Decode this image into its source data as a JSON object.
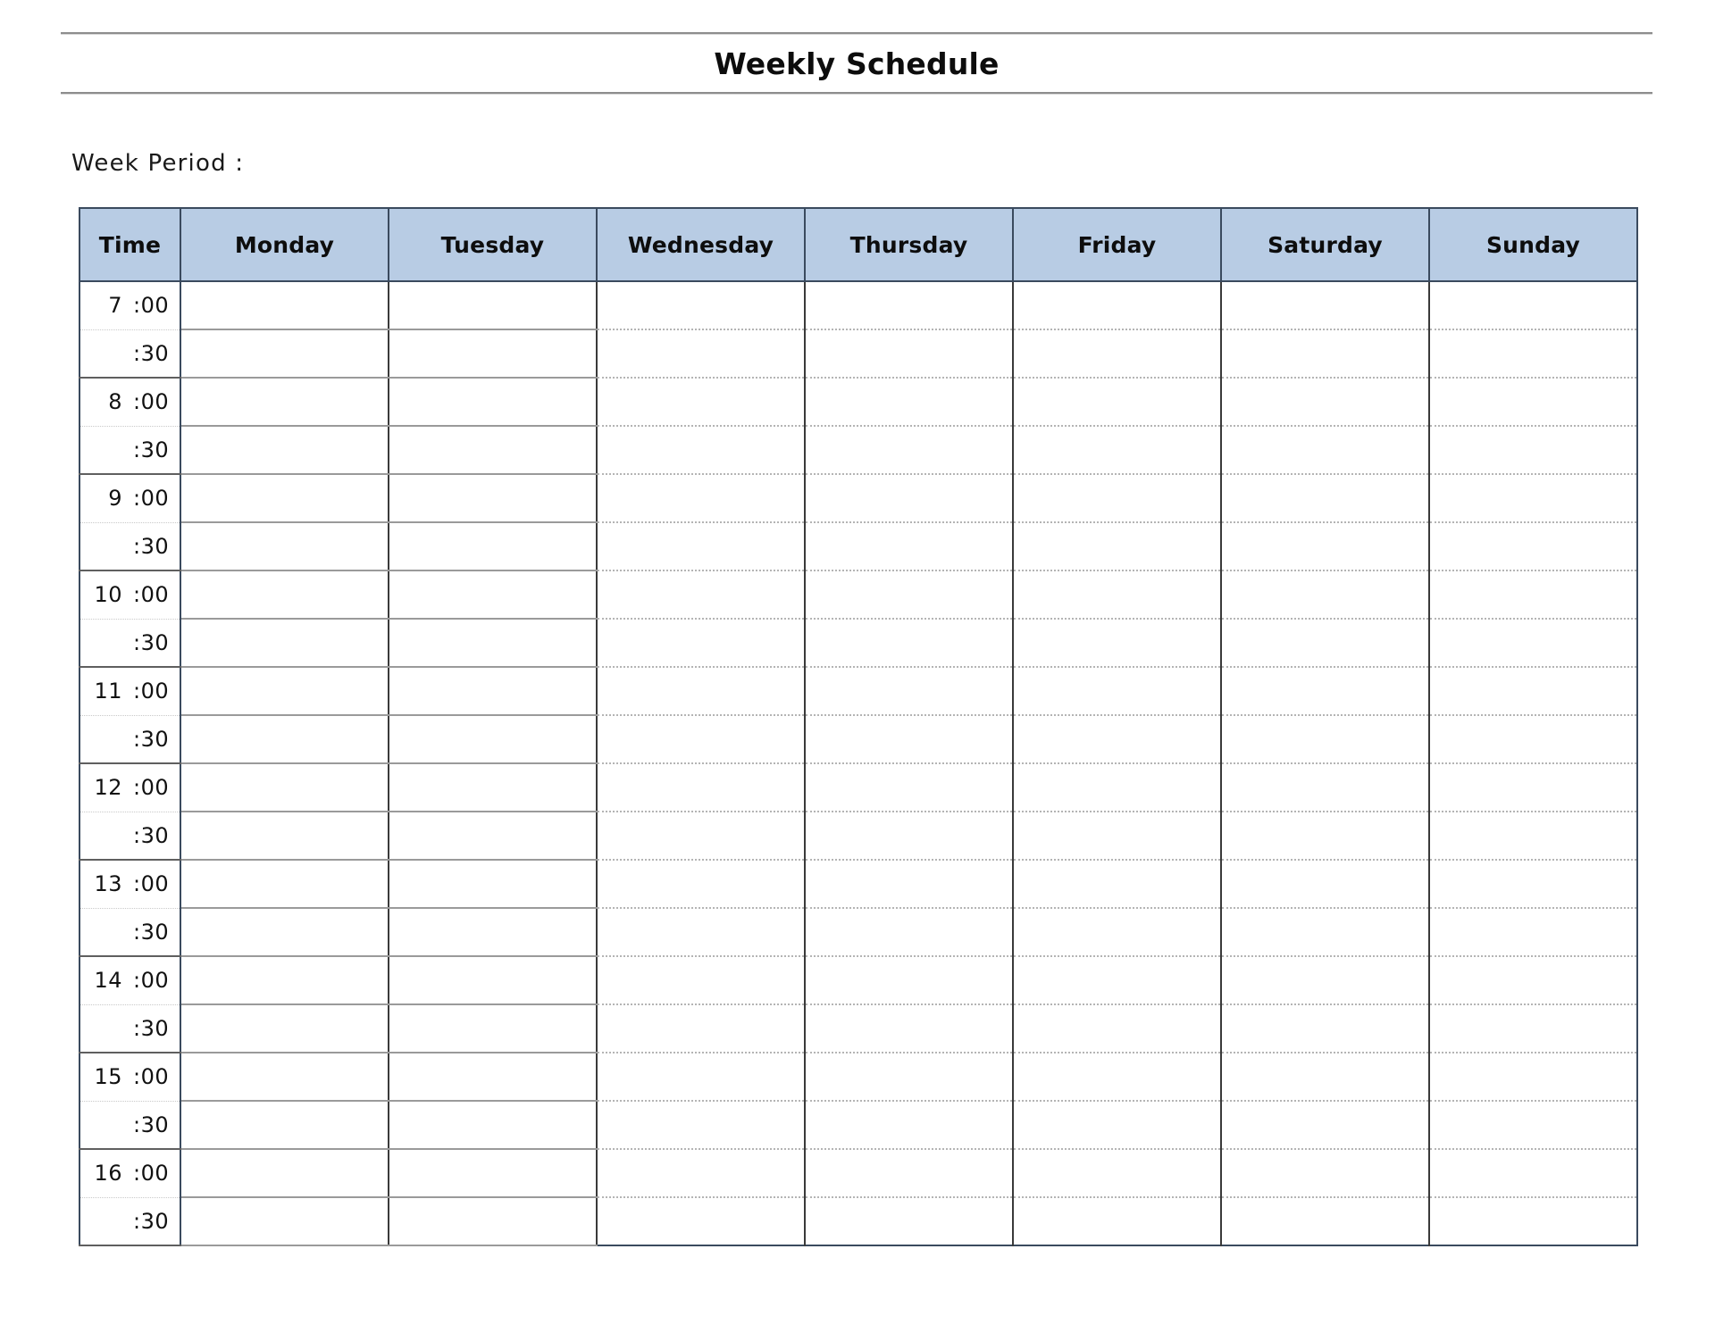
{
  "document": {
    "title": "Weekly Schedule",
    "week_period_label": "Week Period :"
  },
  "table": {
    "columns": [
      {
        "key": "time",
        "label": "Time",
        "type": "time"
      },
      {
        "key": "monday",
        "label": "Monday",
        "type": "day",
        "line_style": "solid"
      },
      {
        "key": "tuesday",
        "label": "Tuesday",
        "type": "day",
        "line_style": "solid"
      },
      {
        "key": "wednesday",
        "label": "Wednesday",
        "type": "day",
        "line_style": "dotted"
      },
      {
        "key": "thursday",
        "label": "Thursday",
        "type": "day",
        "line_style": "dotted"
      },
      {
        "key": "friday",
        "label": "Friday",
        "type": "day",
        "line_style": "dotted"
      },
      {
        "key": "saturday",
        "label": "Saturday",
        "type": "day",
        "line_style": "dotted"
      },
      {
        "key": "sunday",
        "label": "Sunday",
        "type": "day",
        "line_style": "dotted"
      }
    ],
    "header_background": "#b8cce4",
    "header_border": "#3a4a5e",
    "rows": [
      {
        "hour": "7",
        "mins": ":00",
        "slot": "00"
      },
      {
        "hour": "",
        "mins": ":30",
        "slot": "30"
      },
      {
        "hour": "8",
        "mins": ":00",
        "slot": "00"
      },
      {
        "hour": "",
        "mins": ":30",
        "slot": "30"
      },
      {
        "hour": "9",
        "mins": ":00",
        "slot": "00"
      },
      {
        "hour": "",
        "mins": ":30",
        "slot": "30"
      },
      {
        "hour": "10",
        "mins": ":00",
        "slot": "00"
      },
      {
        "hour": "",
        "mins": ":30",
        "slot": "30"
      },
      {
        "hour": "11",
        "mins": ":00",
        "slot": "00"
      },
      {
        "hour": "",
        "mins": ":30",
        "slot": "30"
      },
      {
        "hour": "12",
        "mins": ":00",
        "slot": "00"
      },
      {
        "hour": "",
        "mins": ":30",
        "slot": "30"
      },
      {
        "hour": "13",
        "mins": ":00",
        "slot": "00"
      },
      {
        "hour": "",
        "mins": ":30",
        "slot": "30"
      },
      {
        "hour": "14",
        "mins": ":00",
        "slot": "00"
      },
      {
        "hour": "",
        "mins": ":30",
        "slot": "30"
      },
      {
        "hour": "15",
        "mins": ":00",
        "slot": "00"
      },
      {
        "hour": "",
        "mins": ":30",
        "slot": "30"
      },
      {
        "hour": "16",
        "mins": ":00",
        "slot": "00"
      },
      {
        "hour": "",
        "mins": ":30",
        "slot": "30"
      }
    ],
    "cell_values": []
  }
}
